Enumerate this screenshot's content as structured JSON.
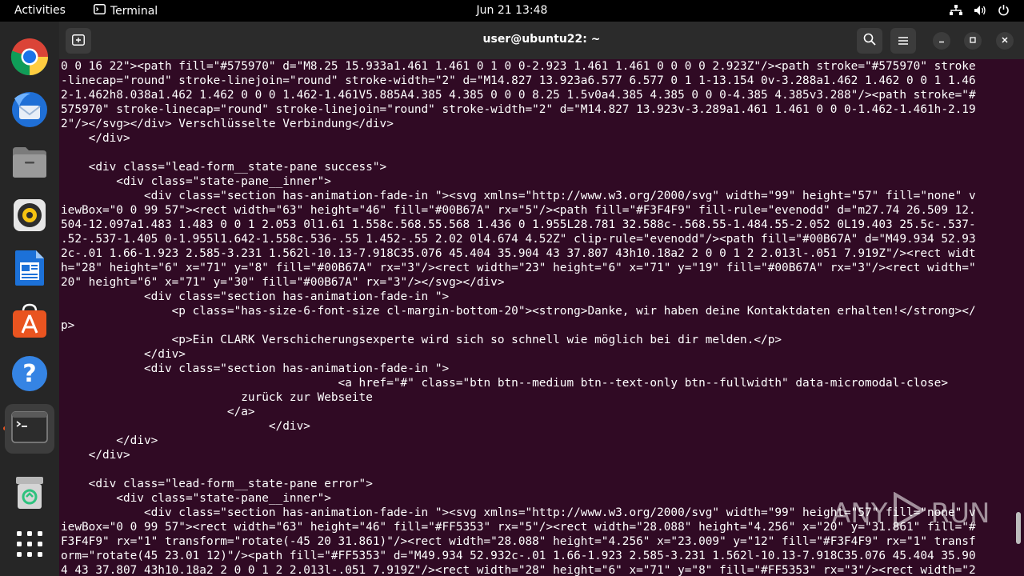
{
  "topbar": {
    "activities": "Activities",
    "app_name": "Terminal",
    "clock": "Jun 21  13:48",
    "tray_icons": [
      "network-icon",
      "volume-icon",
      "power-icon"
    ]
  },
  "dock": {
    "items": [
      {
        "name": "chrome",
        "icon": "chrome-icon"
      },
      {
        "name": "thunderbird",
        "icon": "thunderbird-icon"
      },
      {
        "name": "files",
        "icon": "files-icon"
      },
      {
        "name": "rhythmbox",
        "icon": "rhythmbox-icon"
      },
      {
        "name": "writer",
        "icon": "writer-icon"
      },
      {
        "name": "software",
        "icon": "software-icon"
      },
      {
        "name": "help",
        "icon": "help-icon"
      },
      {
        "name": "terminal",
        "icon": "terminal-icon",
        "active": true
      },
      {
        "name": "trash",
        "icon": "trash-icon"
      },
      {
        "name": "show-apps",
        "icon": "apps-grid-icon"
      }
    ]
  },
  "terminal": {
    "title": "user@ubuntu22: ~",
    "colors": {
      "background": "#300a24",
      "text": "#ffffff",
      "header": "#2b2b2b"
    },
    "lines": [
      "0 0 16 22\"><path fill=\"#575970\" d=\"M8.25 15.933a1.461 1.461 0 1 0 0-2.923 1.461 1.461 0 0 0 0 2.923Z\"/><path stroke=\"#575970\" stroke",
      "-linecap=\"round\" stroke-linejoin=\"round\" stroke-width=\"2\" d=\"M14.827 13.923a6.577 6.577 0 1 1-13.154 0v-3.288a1.462 1.462 0 0 1 1.46",
      "2-1.462h8.038a1.462 1.462 0 0 0 1.462-1.461V5.885A4.385 4.385 0 0 0 8.25 1.5v0a4.385 4.385 0 0 0-4.385 4.385v3.288\"/><path stroke=\"#",
      "575970\" stroke-linecap=\"round\" stroke-linejoin=\"round\" stroke-width=\"2\" d=\"M14.827 13.923v-3.289a1.461 1.461 0 0 0-1.462-1.461h-2.19",
      "2\"/></svg></div> Verschlüsselte Verbindung</div>",
      "    </div>",
      "",
      "    <div class=\"lead-form__state-pane success\">",
      "        <div class=\"state-pane__inner\">",
      "            <div class=\"section has-animation-fade-in \"><svg xmlns=\"http://www.w3.org/2000/svg\" width=\"99\" height=\"57\" fill=\"none\" v",
      "iewBox=\"0 0 99 57\"><rect width=\"63\" height=\"46\" fill=\"#00B67A\" rx=\"5\"/><path fill=\"#F3F4F9\" fill-rule=\"evenodd\" d=\"m27.74 26.509 12.",
      "504-12.097a1.483 1.483 0 0 1 2.053 0l1.61 1.558c.568.55.568 1.436 0 1.955L28.781 32.588c-.568.55-1.484.55-2.052 0L19.403 25.5c-.537-",
      ".52-.537-1.405 0-1.955l1.642-1.558c.536-.55 1.452-.55 2.02 0l4.674 4.52Z\" clip-rule=\"evenodd\"/><path fill=\"#00B67A\" d=\"M49.934 52.93",
      "2c-.01 1.66-1.923 2.585-3.231 1.562l-10.13-7.918C35.076 45.404 35.904 43 37.807 43h10.18a2 2 0 0 1 2 2.013l-.051 7.919Z\"/><rect widt",
      "h=\"28\" height=\"6\" x=\"71\" y=\"8\" fill=\"#00B67A\" rx=\"3\"/><rect width=\"23\" height=\"6\" x=\"71\" y=\"19\" fill=\"#00B67A\" rx=\"3\"/><rect width=\"",
      "20\" height=\"6\" x=\"71\" y=\"30\" fill=\"#00B67A\" rx=\"3\"/></svg></div>",
      "            <div class=\"section has-animation-fade-in \">",
      "                <p class=\"has-size-6-font-size cl-margin-bottom-20\"><strong>Danke, wir haben deine Kontaktdaten erhalten!</strong></",
      "p>",
      "                <p>Ein CLARK Verschicherungsexperte wird sich so schnell wie möglich bei dir melden.</p>",
      "            </div>",
      "            <div class=\"section has-animation-fade-in \">",
      "                                        <a href=\"#\" class=\"btn btn--medium btn--text-only btn--fullwidth\" data-micromodal-close>",
      "                          zurück zur Webseite",
      "                        </a>",
      "                              </div>",
      "        </div>",
      "    </div>",
      "",
      "    <div class=\"lead-form__state-pane error\">",
      "        <div class=\"state-pane__inner\">",
      "            <div class=\"section has-animation-fade-in \"><svg xmlns=\"http://www.w3.org/2000/svg\" width=\"99\" height=\"57\" fill=\"none\" v",
      "iewBox=\"0 0 99 57\"><rect width=\"63\" height=\"46\" fill=\"#FF5353\" rx=\"5\"/><rect width=\"28.088\" height=\"4.256\" x=\"20\" y=\"31.861\" fill=\"#",
      "F3F4F9\" rx=\"1\" transform=\"rotate(-45 20 31.861)\"/><rect width=\"28.088\" height=\"4.256\" x=\"23.009\" y=\"12\" fill=\"#F3F4F9\" rx=\"1\" transf",
      "orm=\"rotate(45 23.01 12)\"/><path fill=\"#FF5353\" d=\"M49.934 52.932c-.01 1.66-1.923 2.585-3.231 1.562l-10.13-7.918C35.076 45.404 35.90",
      "4 43 37.807 43h10.18a2 2 0 0 1 2 2.013l-.051 7.919Z\"/><rect width=\"28\" height=\"6\" x=\"71\" y=\"8\" fill=\"#FF5353\" rx=\"3\"/><rect width=\"2"
    ]
  },
  "watermark": {
    "text": "ANY",
    "text2": "RUN"
  }
}
